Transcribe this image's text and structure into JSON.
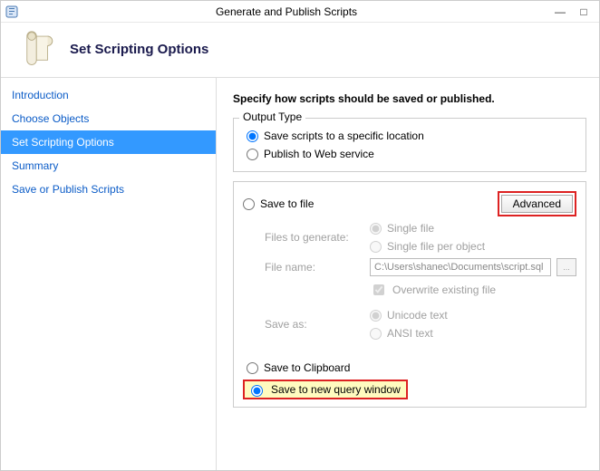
{
  "titlebar": {
    "title": "Generate and Publish Scripts",
    "minimize": "—",
    "maximize": "□"
  },
  "header": {
    "heading": "Set Scripting Options"
  },
  "sidebar": {
    "items": [
      {
        "label": "Introduction"
      },
      {
        "label": "Choose Objects"
      },
      {
        "label": "Set Scripting Options"
      },
      {
        "label": "Summary"
      },
      {
        "label": "Save or Publish Scripts"
      }
    ]
  },
  "content": {
    "instruction": "Specify how scripts should be saved or published.",
    "outputType": {
      "legend": "Output Type",
      "opt1": "Save scripts to a specific location",
      "opt2": "Publish to Web service"
    },
    "dest": {
      "saveToFile": "Save to file",
      "advanced": "Advanced",
      "filesToGenerateLabel": "Files to generate:",
      "singleFile": "Single file",
      "singleFilePerObject": "Single file per object",
      "fileNameLabel": "File name:",
      "fileNameValue": "C:\\Users\\shanec\\Documents\\script.sql",
      "overwrite": "Overwrite existing file",
      "saveAsLabel": "Save as:",
      "unicode": "Unicode text",
      "ansi": "ANSI text",
      "saveToClipboard": "Save to Clipboard",
      "saveToNewQuery": "Save to new query window"
    }
  }
}
